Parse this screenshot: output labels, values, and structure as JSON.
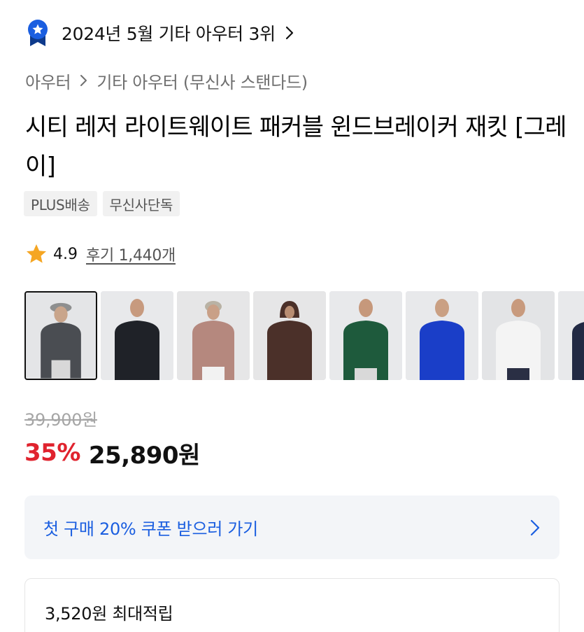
{
  "ranking": {
    "text": "2024년 5월 기타 아우터 3위",
    "badge_color": "#1a5ee0"
  },
  "breadcrumb": {
    "category": "아우터",
    "subcategory": "기타 아우터 (무신사 스탠다드)"
  },
  "product": {
    "title": "시티 레저 라이트웨이트 패커블 윈드브레이커 재킷 [그레이]"
  },
  "tags": [
    "PLUS배송",
    "무신사단독"
  ],
  "rating": {
    "score": "4.9",
    "reviews_label": "후기 1,440개",
    "star_color": "#f5a623"
  },
  "thumbnails": [
    {
      "name": "gray",
      "color": "#4a4d52"
    },
    {
      "name": "black",
      "color": "#1f2228"
    },
    {
      "name": "pink",
      "color": "#b5887e"
    },
    {
      "name": "brown",
      "color": "#4b3029"
    },
    {
      "name": "green",
      "color": "#1e5a3c"
    },
    {
      "name": "blue",
      "color": "#1a3ec8"
    },
    {
      "name": "white",
      "color": "#f4f4f4"
    },
    {
      "name": "navy",
      "color": "#222a44"
    }
  ],
  "price": {
    "original": "39,900원",
    "discount": "35%",
    "final": "25,890원"
  },
  "coupon": {
    "text": "첫 구매 20% 쿠폰 받으러 가기"
  },
  "points": {
    "text": "3,520원 최대적립"
  },
  "colors": {
    "discount": "#e0232e",
    "coupon_text": "#1a5ee0",
    "coupon_bg": "#f3f5f8"
  }
}
